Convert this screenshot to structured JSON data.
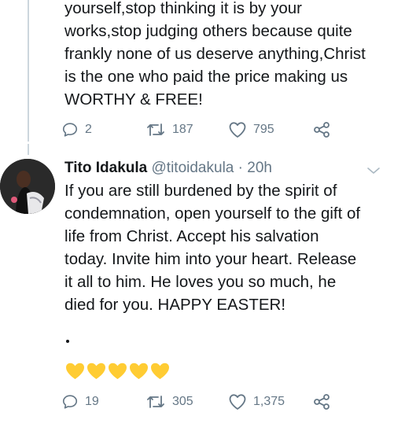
{
  "tweet1": {
    "text": "yourself,stop thinking it is by your\nworks,stop judging others because quite\nfrankly none of us deserve anything,Christ\nis the one who paid the price making us\nWORTHY & FREE!",
    "replies": "2",
    "retweets": "187",
    "likes": "795"
  },
  "tweet2": {
    "name": "Tito Idakula",
    "handle": "@titoidakula",
    "separator": "·",
    "time": "20h",
    "text": "If you are still burdened by the spirit of\ncondemnation, open yourself to the gift of\nlife from Christ. Accept his salvation\ntoday. Invite him into your heart. Release\nit all to him. He loves you so much, he\ndied for you. HAPPY EASTER!",
    "trailing": ".",
    "emoji_hearts": [
      "yellow-heart",
      "yellow-heart",
      "yellow-heart",
      "yellow-heart",
      "yellow-heart"
    ],
    "replies": "19",
    "retweets": "305",
    "likes": "1,375"
  },
  "colors": {
    "text": "#14171a",
    "muted": "#657786",
    "thread_line": "#ccd6dd",
    "heart": "#ffcc33"
  },
  "icons": [
    "reply-icon",
    "retweet-icon",
    "like-icon",
    "share-icon",
    "chevron-down-icon"
  ]
}
